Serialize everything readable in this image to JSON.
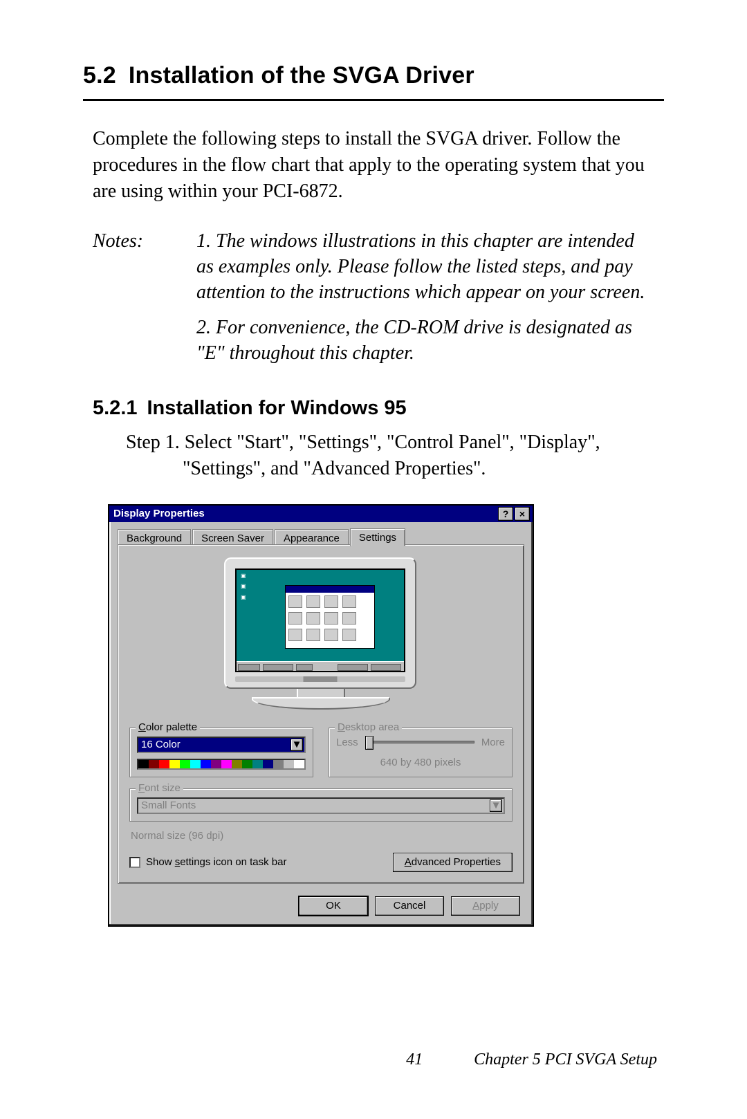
{
  "section": {
    "number": "5.2",
    "title": "Installation of the SVGA Driver"
  },
  "intro": "Complete the following steps to install the SVGA driver. Follow the procedures in the flow chart that apply to the operating system that you are using within your PCI-6872.",
  "notes": {
    "label": "Notes:",
    "items": [
      "1.  The windows illustrations in this chapter are intended as examples only. Please follow the listed steps, and pay attention to the instructions which appear on your screen.",
      "2.  For convenience, the CD-ROM drive is designated as \"E\" throughout this chapter."
    ]
  },
  "subsection": {
    "number": "5.2.1",
    "title": "Installation for Windows 95"
  },
  "step1": "Step 1.  Select \"Start\", \"Settings\", \"Control Panel\", \"Display\", \"Settings\", and \"Advanced Properties\".",
  "dialog": {
    "title": "Display Properties",
    "help_glyph": "?",
    "close_glyph": "×",
    "tabs": [
      "Background",
      "Screen Saver",
      "Appearance",
      "Settings"
    ],
    "active_tab": "Settings",
    "color_palette": {
      "label": "Color palette",
      "value": "16 Color",
      "underline_char": "C"
    },
    "desktop_area": {
      "label": "Desktop area",
      "underline_char": "D",
      "less": "Less",
      "more": "More",
      "resolution": "640 by 480 pixels"
    },
    "font_size": {
      "label": "Font size",
      "underline_char": "F",
      "value": "Small Fonts"
    },
    "dpi_label": "Normal size (96 dpi)",
    "show_settings": {
      "label_pre": "Show ",
      "label_ul": "s",
      "label_post": "ettings icon on task bar"
    },
    "advanced_btn": {
      "pre": "",
      "ul": "A",
      "post": "dvanced Properties"
    },
    "ok": "OK",
    "cancel": "Cancel",
    "apply": {
      "ul": "A",
      "post": "pply"
    }
  },
  "palette_colors": [
    "#000000",
    "#800000",
    "#ff0000",
    "#ffff00",
    "#00ff00",
    "#00ffff",
    "#0000ff",
    "#800080",
    "#ff00ff",
    "#808000",
    "#008000",
    "#008080",
    "#000080",
    "#808080",
    "#c0c0c0",
    "#ffffff"
  ],
  "footer": {
    "page": "41",
    "chapter": "Chapter 5  PCI SVGA Setup"
  }
}
